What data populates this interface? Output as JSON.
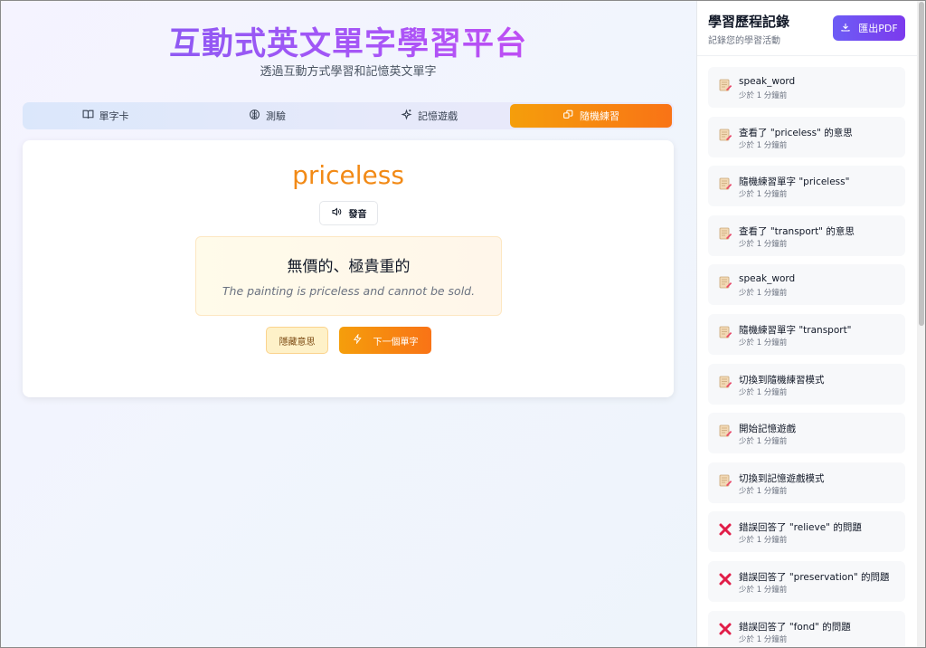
{
  "header": {
    "title": "互動式英文單字學習平台",
    "subtitle": "透過互動方式學習和記憶英文單字"
  },
  "tabs": [
    {
      "label": "單字卡",
      "icon": "book-icon",
      "active": false
    },
    {
      "label": "測驗",
      "icon": "brain-icon",
      "active": false
    },
    {
      "label": "記憶遊戲",
      "icon": "sparkles-icon",
      "active": false
    },
    {
      "label": "隨機練習",
      "icon": "shuffle-icon",
      "active": true
    }
  ],
  "card": {
    "word": "priceless",
    "speak_label": "發音",
    "meaning": "無價的、極貴重的",
    "example": "The painting is priceless and cannot be sold.",
    "hide_label": "隱藏意思",
    "next_label": "下一個單字"
  },
  "sidebar": {
    "title": "學習歷程記錄",
    "subtitle": "記錄您的學習活動",
    "export_label": "匯出PDF",
    "items": [
      {
        "text": "speak_word",
        "time": "少於 1 分鐘前",
        "icon": "memo-icon"
      },
      {
        "text": "查看了 \"priceless\" 的意思",
        "time": "少於 1 分鐘前",
        "icon": "memo-icon"
      },
      {
        "text": "隨機練習單字 \"priceless\"",
        "time": "少於 1 分鐘前",
        "icon": "memo-icon"
      },
      {
        "text": "查看了 \"transport\" 的意思",
        "time": "少於 1 分鐘前",
        "icon": "memo-icon"
      },
      {
        "text": "speak_word",
        "time": "少於 1 分鐘前",
        "icon": "memo-icon"
      },
      {
        "text": "隨機練習單字 \"transport\"",
        "time": "少於 1 分鐘前",
        "icon": "memo-icon"
      },
      {
        "text": "切換到隨機練習模式",
        "time": "少於 1 分鐘前",
        "icon": "memo-icon"
      },
      {
        "text": "開始記憶遊戲",
        "time": "少於 1 分鐘前",
        "icon": "memo-icon"
      },
      {
        "text": "切換到記憶遊戲模式",
        "time": "少於 1 分鐘前",
        "icon": "memo-icon"
      },
      {
        "text": "錯誤回答了 \"relieve\" 的問題",
        "time": "少於 1 分鐘前",
        "icon": "cross-icon"
      },
      {
        "text": "錯誤回答了 \"preservation\" 的問題",
        "time": "少於 1 分鐘前",
        "icon": "cross-icon"
      },
      {
        "text": "錯誤回答了 \"fond\" 的問題",
        "time": "少於 1 分鐘前",
        "icon": "cross-icon"
      }
    ]
  },
  "colors": {
    "accent_orange": "#f97316",
    "accent_purple": "#7c3aed",
    "word_color": "#f28a16",
    "error_red": "#e11d48"
  }
}
